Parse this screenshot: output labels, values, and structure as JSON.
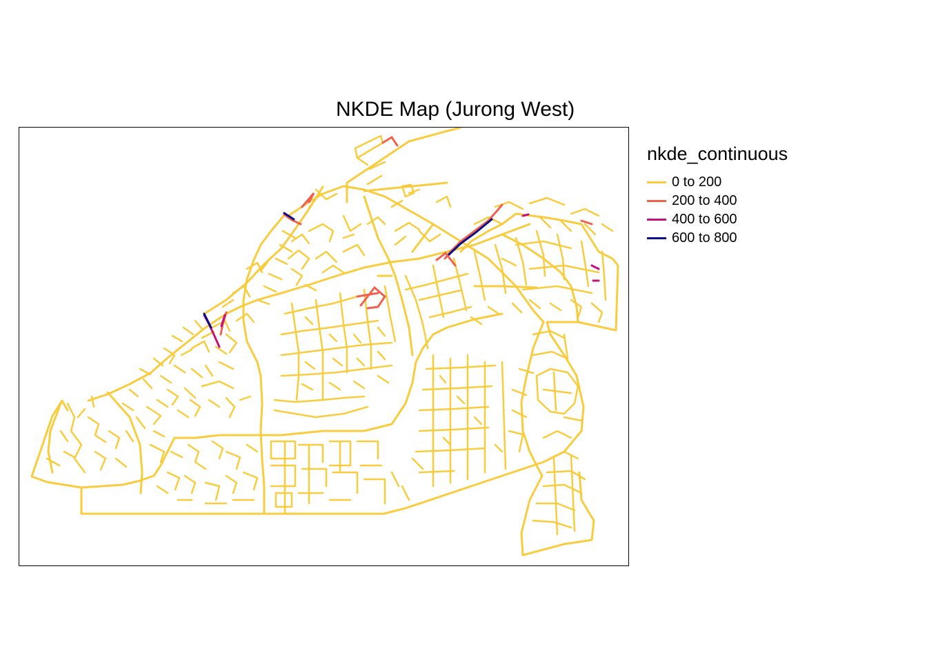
{
  "title": "NKDE Map (Jurong West)",
  "legend": {
    "title": "nkde_continuous",
    "items": [
      {
        "label": "0 to 200",
        "color": "#F9CC3D"
      },
      {
        "label": "200 to 400",
        "color": "#F0604D"
      },
      {
        "label": "400 to 600",
        "color": "#C2117A"
      },
      {
        "label": "600 to 800",
        "color": "#0A0A8A"
      }
    ]
  },
  "map": {
    "network_color": "#F9CC3D",
    "hotspot_colors": {
      "medium": "#F0604D",
      "high": "#C2117A",
      "highest": "#0A0A8A"
    }
  }
}
